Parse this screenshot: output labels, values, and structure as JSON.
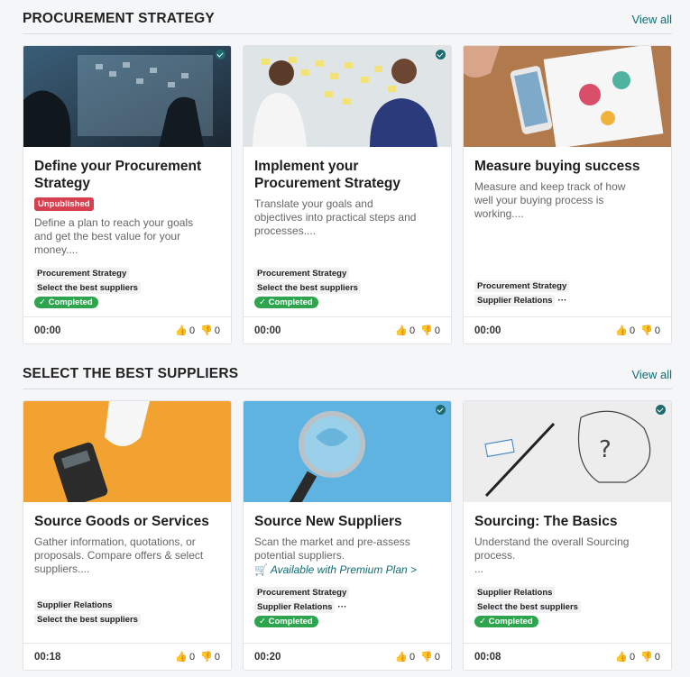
{
  "sections": [
    {
      "title": "PROCUREMENT STRATEGY",
      "view_all": "View all",
      "cards": [
        {
          "title_l1": "Define your Procurement",
          "title_l2": "Strategy",
          "badge": "Unpublished",
          "desc_l1": "Define a plan to reach your goals",
          "desc_l2": "and get the best value for your",
          "desc_l3": "money....",
          "tag1": "Procurement Strategy",
          "tag2": "Select the best suppliers",
          "status": "Completed",
          "duration": "00:00",
          "likes": "0",
          "dislikes": "0"
        },
        {
          "title_l1": "Implement your",
          "title_l2": "Procurement Strategy",
          "desc_l1": "Translate your goals and",
          "desc_l2": "objectives into practical steps and",
          "desc_l3": "processes....",
          "tag1": "Procurement Strategy",
          "tag2": "Select the best suppliers",
          "status": "Completed",
          "duration": "00:00",
          "likes": "0",
          "dislikes": "0"
        },
        {
          "title_l1": "Measure buying success",
          "desc_l1": "Measure and keep track of how",
          "desc_l2": "well your buying process is",
          "desc_l3": "working....",
          "tag1": "Procurement Strategy",
          "tag2": "Supplier Relations",
          "more": "···",
          "duration": "00:00",
          "likes": "0",
          "dislikes": "0"
        }
      ]
    },
    {
      "title": "SELECT THE BEST SUPPLIERS",
      "view_all": "View all",
      "cards": [
        {
          "title_l1": "Source Goods or Services",
          "desc_l1": "Gather information, quotations, or",
          "desc_l2": "proposals. Compare offers & select",
          "desc_l3": "suppliers....",
          "tag1": "Supplier Relations",
          "tag2": "Select the best suppliers",
          "duration": "00:18",
          "likes": "0",
          "dislikes": "0"
        },
        {
          "title_l1": "Source New Suppliers",
          "desc_l1": "Scan the market and pre-assess",
          "desc_l2": "potential suppliers.",
          "premium": "Available with Premium Plan >",
          "tag1": "Procurement Strategy",
          "tag2": "Supplier Relations",
          "more": "···",
          "status": "Completed",
          "duration": "00:20",
          "likes": "0",
          "dislikes": "0"
        },
        {
          "title_l1": "Sourcing: The Basics",
          "desc_l1": "Understand the overall Sourcing",
          "desc_l2": "process.",
          "desc_l3": "...",
          "tag1": "Supplier Relations",
          "tag2": "Select the best suppliers",
          "status": "Completed",
          "duration": "00:08",
          "likes": "0",
          "dislikes": "0"
        }
      ]
    }
  ],
  "colors": {
    "accent": "#0e6e74",
    "completed": "#2ea44f",
    "unpublished": "#d64050"
  }
}
